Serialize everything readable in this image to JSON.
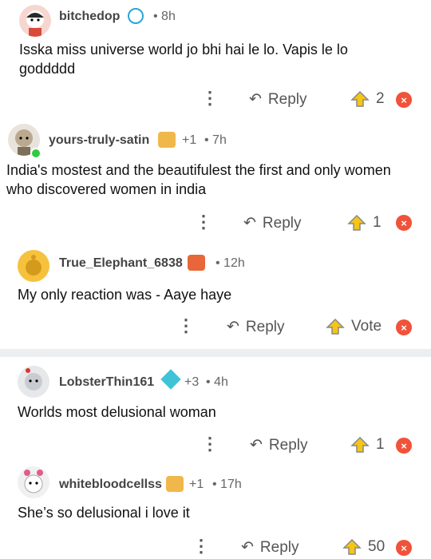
{
  "comments": [
    {
      "user": "bitchedop",
      "time": "• 8h",
      "body": "Isska miss universe world jo bhi hai le lo. Vapis le lo goddddd",
      "reply": "Reply",
      "votes": "2"
    },
    {
      "user": "yours-truly-satin",
      "karma": "+1",
      "time": "• 7h",
      "body": "India's mostest and the beautifulest the first and only women who discovered women in india",
      "reply": "Reply",
      "votes": "1"
    },
    {
      "user": "True_Elephant_6838",
      "time": "• 12h",
      "body": "My only reaction was - Aaye haye",
      "reply": "Reply",
      "votes": "Vote"
    },
    {
      "user": "LobsterThin161",
      "karma": "+3",
      "time": "• 4h",
      "body": "Worlds most delusional woman",
      "reply": "Reply",
      "votes": "1"
    },
    {
      "user": "whitebloodcellss",
      "karma": "+1",
      "time": "• 17h",
      "body": "She’s so delusional i love it",
      "reply": "Reply",
      "votes": "50"
    }
  ],
  "icons": {
    "more": "more-vertical-icon",
    "reply": "reply-arrow-icon",
    "upvote": "upvote-icon",
    "close": "close-icon"
  },
  "colors": {
    "accent": "#f0523a",
    "upvote": "#f5c518"
  }
}
